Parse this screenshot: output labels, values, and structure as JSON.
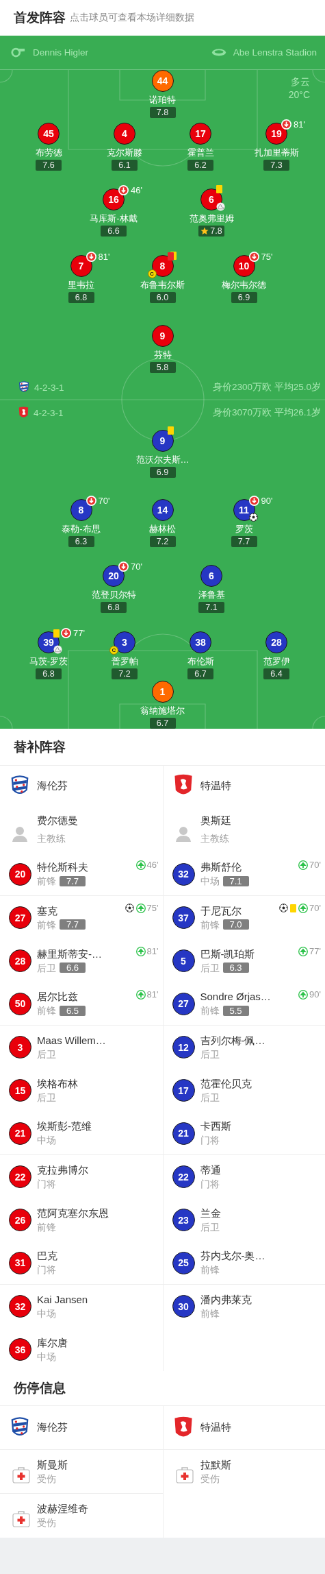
{
  "lineup": {
    "title": "首发阵容",
    "hint": "点击球员可查看本场详细数据",
    "referee": "Dennis Higler",
    "stadium": "Abe Lenstra Stadion",
    "weather": "多云",
    "temperature": "20°C",
    "home": {
      "formation": "4-2-3-1",
      "summary": "身价2300万欧 平均25.0岁",
      "rows": [
        [
          {
            "number": "44",
            "name": "诺珀特",
            "rating": "7.8",
            "color": "#ff6a00"
          }
        ],
        [
          {
            "number": "45",
            "name": "布劳德",
            "rating": "7.6",
            "color": "#e8000b"
          },
          {
            "number": "4",
            "name": "克尔斯滕",
            "rating": "6.1",
            "color": "#e8000b"
          },
          {
            "number": "17",
            "name": "霍普兰",
            "rating": "6.2",
            "color": "#e8000b"
          },
          {
            "number": "19",
            "name": "扎加里蒂斯",
            "rating": "7.3",
            "color": "#e8000b",
            "events": [
              {
                "kind": "sub_off",
                "minute": "81'"
              }
            ]
          }
        ],
        [
          {
            "number": "16",
            "name": "马库斯-林戴",
            "rating": "6.6",
            "color": "#e8000b",
            "events": [
              {
                "kind": "sub_off",
                "minute": "46'"
              }
            ]
          },
          {
            "number": "6",
            "name": "范奥弗里姆",
            "rating": "7.8",
            "color": "#e8000b",
            "events": [
              {
                "kind": "card_yellow"
              },
              {
                "kind": "assist"
              },
              {
                "kind": "best"
              }
            ]
          }
        ],
        [
          {
            "number": "7",
            "name": "里韦拉",
            "rating": "6.8",
            "color": "#e8000b",
            "events": [
              {
                "kind": "sub_off",
                "minute": "81'"
              }
            ]
          },
          {
            "number": "8",
            "name": "布鲁韦尔斯",
            "rating": "6.0",
            "color": "#e8000b",
            "events": [
              {
                "kind": "card_second_yellow"
              },
              {
                "kind": "captain",
                "label": "C"
              }
            ]
          },
          {
            "number": "10",
            "name": "梅尔韦尔德",
            "rating": "6.9",
            "color": "#e8000b",
            "events": [
              {
                "kind": "sub_off",
                "minute": "75'"
              }
            ]
          }
        ],
        [
          {
            "number": "9",
            "name": "芬特",
            "rating": "5.8",
            "color": "#e8000b"
          }
        ]
      ]
    },
    "away": {
      "formation": "4-2-3-1",
      "summary": "身价3070万欧 平均26.1岁",
      "rows": [
        [
          {
            "number": "9",
            "name": "范沃尔夫斯…",
            "rating": "6.9",
            "color": "#2637c4",
            "events": [
              {
                "kind": "card_yellow"
              }
            ]
          }
        ],
        [
          {
            "number": "8",
            "name": "泰勒-布思",
            "rating": "6.3",
            "color": "#2637c4",
            "events": [
              {
                "kind": "sub_off",
                "minute": "70'"
              }
            ]
          },
          {
            "number": "14",
            "name": "赫林松",
            "rating": "7.2",
            "color": "#2637c4"
          },
          {
            "number": "11",
            "name": "罗茨",
            "rating": "7.7",
            "color": "#2637c4",
            "events": [
              {
                "kind": "sub_off",
                "minute": "90'"
              },
              {
                "kind": "goal"
              }
            ]
          }
        ],
        [
          {
            "number": "20",
            "name": "范登贝尔特",
            "rating": "6.8",
            "color": "#2637c4",
            "events": [
              {
                "kind": "sub_off",
                "minute": "70'"
              }
            ]
          },
          {
            "number": "6",
            "name": "泽鲁基",
            "rating": "7.1",
            "color": "#2637c4"
          }
        ],
        [
          {
            "number": "39",
            "name": "马茨-罗茨",
            "rating": "6.8",
            "color": "#2637c4",
            "events": [
              {
                "kind": "card_yellow"
              },
              {
                "kind": "sub_off",
                "minute": "77'"
              },
              {
                "kind": "assist"
              }
            ]
          },
          {
            "number": "3",
            "name": "普罗帕",
            "rating": "7.2",
            "color": "#2637c4",
            "events": [
              {
                "kind": "captain",
                "label": "C"
              }
            ]
          },
          {
            "number": "38",
            "name": "布伦斯",
            "rating": "6.7",
            "color": "#2637c4"
          },
          {
            "number": "28",
            "name": "范罗伊",
            "rating": "6.4",
            "color": "#2637c4"
          }
        ],
        [
          {
            "number": "1",
            "name": "翁纳施塔尔",
            "rating": "6.7",
            "color": "#ff6a00"
          }
        ]
      ]
    }
  },
  "subs": {
    "title": "替补阵容",
    "teams": [
      {
        "name": "海伦芬",
        "color": "#e8000b",
        "coach": "费尔德曼",
        "coach_role": "主教练",
        "players": [
          {
            "number": "20",
            "name": "特伦斯科夫",
            "position": "前锋",
            "rating": "7.7",
            "events": [
              {
                "kind": "sub_on",
                "minute": "46'"
              }
            ]
          },
          {
            "number": "27",
            "name": "塞克",
            "position": "前锋",
            "rating": "7.7",
            "events": [
              {
                "kind": "goal"
              },
              {
                "kind": "sub_on",
                "minute": "75'"
              }
            ]
          },
          {
            "number": "28",
            "name": "赫里斯蒂安-…",
            "position": "后卫",
            "rating": "6.6",
            "events": [
              {
                "kind": "sub_on",
                "minute": "81'"
              }
            ]
          },
          {
            "number": "50",
            "name": "居尔比兹",
            "position": "前锋",
            "rating": "6.5",
            "events": [
              {
                "kind": "sub_on",
                "minute": "81'"
              }
            ]
          },
          {
            "number": "3",
            "name": "Maas Willem…",
            "position": "后卫"
          },
          {
            "number": "15",
            "name": "埃格布林",
            "position": "后卫"
          },
          {
            "number": "21",
            "name": "埃斯彭-范维",
            "position": "中场"
          },
          {
            "number": "22",
            "name": "克拉弗博尔",
            "position": "门将"
          },
          {
            "number": "26",
            "name": "范阿克塞尔东恩",
            "position": "前锋"
          },
          {
            "number": "31",
            "name": "巴克",
            "position": "门将"
          },
          {
            "number": "32",
            "name": "Kai Jansen",
            "position": "中场"
          },
          {
            "number": "36",
            "name": "库尔唐",
            "position": "中场"
          }
        ]
      },
      {
        "name": "特温特",
        "color": "#2637c4",
        "coach": "奥斯廷",
        "coach_role": "主教练",
        "players": [
          {
            "number": "32",
            "name": "弗斯舒伦",
            "position": "中场",
            "rating": "7.1",
            "events": [
              {
                "kind": "sub_on",
                "minute": "70'"
              }
            ]
          },
          {
            "number": "37",
            "name": "于尼瓦尔",
            "position": "前锋",
            "rating": "7.0",
            "events": [
              {
                "kind": "goal"
              },
              {
                "kind": "card_yellow"
              },
              {
                "kind": "sub_on",
                "minute": "70'"
              }
            ]
          },
          {
            "number": "5",
            "name": "巴斯-凯珀斯",
            "position": "后卫",
            "rating": "6.3",
            "events": [
              {
                "kind": "sub_on",
                "minute": "77'"
              }
            ]
          },
          {
            "number": "27",
            "name": "Sondre Ørjas…",
            "position": "前锋",
            "rating": "5.5",
            "events": [
              {
                "kind": "sub_on",
                "minute": "90'"
              }
            ]
          },
          {
            "number": "12",
            "name": "吉列尔梅-佩…",
            "position": "后卫"
          },
          {
            "number": "17",
            "name": "范霍伦贝克",
            "position": "后卫"
          },
          {
            "number": "21",
            "name": "卡西斯",
            "position": "门将"
          },
          {
            "number": "22",
            "name": "蒂通",
            "position": "门将"
          },
          {
            "number": "23",
            "name": "兰金",
            "position": "后卫"
          },
          {
            "number": "25",
            "name": "芬内戈尔-奥…",
            "position": "前锋"
          },
          {
            "number": "30",
            "name": "潘内弗莱克",
            "position": "前锋"
          }
        ]
      }
    ]
  },
  "injuries": {
    "title": "伤停信息",
    "teams": [
      {
        "name": "海伦芬",
        "players": [
          {
            "name": "斯曼斯",
            "status": "受伤"
          },
          {
            "name": "波赫涅维奇",
            "status": "受伤"
          }
        ]
      },
      {
        "name": "特温特",
        "players": [
          {
            "name": "拉默斯",
            "status": "受伤"
          }
        ]
      }
    ]
  }
}
